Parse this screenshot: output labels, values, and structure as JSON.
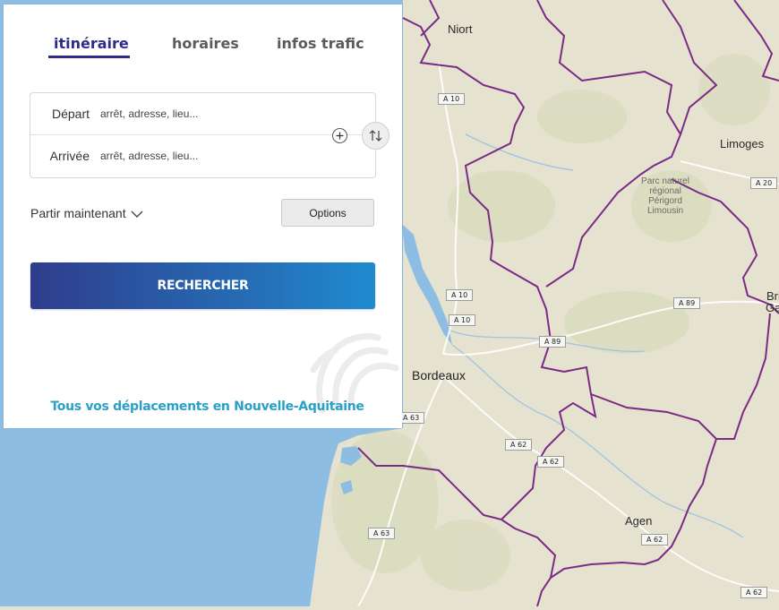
{
  "tabs": [
    {
      "label": "itinéraire",
      "active": true
    },
    {
      "label": "horaires",
      "active": false
    },
    {
      "label": "infos trafic",
      "active": false
    }
  ],
  "form": {
    "departure_label": "Départ",
    "departure_placeholder": "arrêt, adresse, lieu...",
    "departure_value": "",
    "arrival_label": "Arrivée",
    "arrival_placeholder": "arrêt, adresse, lieu...",
    "arrival_value": "",
    "when_label": "Partir maintenant",
    "options_label": "Options",
    "search_label": "RECHERCHER"
  },
  "tagline": "Tous vos déplacements en Nouvelle-Aquitaine",
  "icons": {
    "add": "plus-icon",
    "swap": "swap-arrows-icon",
    "dropdown": "chevron-down-icon",
    "watermark": "lion-icon"
  },
  "colors": {
    "brand": "#2e2c86",
    "button_gradient_start": "#2e3d8c",
    "button_gradient_end": "#1f8bcf",
    "tagline": "#2aa0c6",
    "region_border": "#7b2a86",
    "sea": "#8ebde3",
    "land": "#e6e2d0"
  },
  "map": {
    "cities": [
      "Niort",
      "Limoges",
      "Bordeaux",
      "Agen",
      "Bri",
      "Ga"
    ],
    "park_label": [
      "Parc naturel",
      "régional",
      "Périgord",
      "Limousin"
    ],
    "roads": [
      "A 10",
      "A 10",
      "A 10",
      "A 20",
      "A 89",
      "A 89",
      "A 63",
      "A 62",
      "A 62",
      "A 62",
      "A 62",
      "A 63"
    ]
  }
}
